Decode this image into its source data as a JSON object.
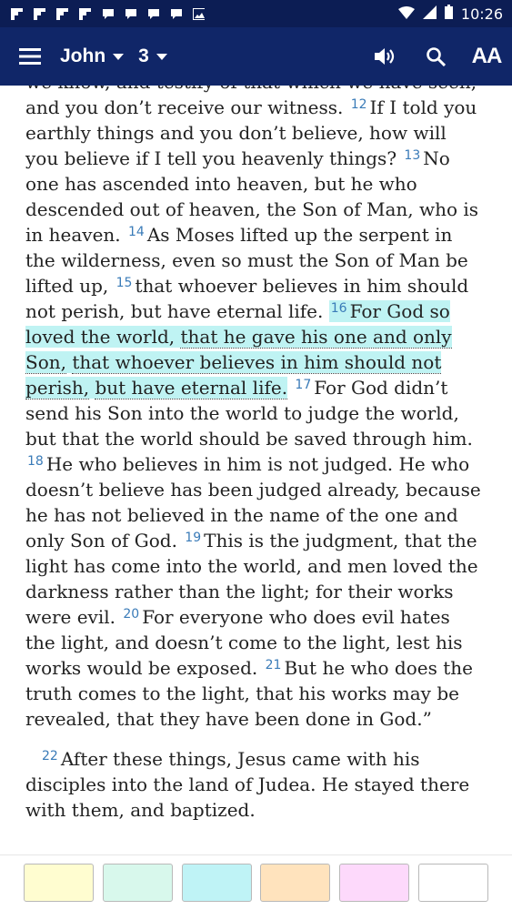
{
  "status_bar": {
    "time": "10:26",
    "notification_icons": [
      "flipboard-icon",
      "flipboard-icon",
      "flipboard-icon",
      "flipboard-icon",
      "message-icon",
      "message-icon",
      "message-icon",
      "message-icon",
      "image-icon"
    ],
    "status_icons": [
      "wifi-icon",
      "signal-icon",
      "battery-icon"
    ]
  },
  "app_bar": {
    "book": "John",
    "chapter": "3",
    "actions": [
      "speaker-icon",
      "search-icon",
      "text-size-icon"
    ],
    "text_size_label": "AA"
  },
  "passage": {
    "p1_top": "we know, and testify of that which we have",
    "p1_a": "seen, and you don’t receive our witness.",
    "v12": "12",
    "t12": "If I told you earthly things and you don’t believe, how will you believe if I tell you heavenly things?",
    "v13": "13",
    "t13": "No one has ascended into heaven, but he who descended out of heaven, the Son of Man, who is in heaven.",
    "v14": "14",
    "t14": "As Moses lifted up the serpent in the wilderness, even so must the Son of Man be lifted up,",
    "v15": "15",
    "t15": "that whoever believes in him should not perish, but have eternal life.",
    "v16": "16",
    "t16a": "For God so loved the world,",
    "t16b": "that he gave his one and only Son,",
    "t16c": "that whoever believes in him should not perish,",
    "t16d": "but have eternal life.",
    "v17": "17",
    "t17": "For God didn’t send his Son into the world to judge the world, but that the world should be saved through him.",
    "v18": "18",
    "t18": "He who believes in him is not judged. He who doesn’t believe has been judged already, because he has not believed in the name of the one and only Son of God.",
    "v19": "19",
    "t19": "This is the judgment, that the light has come into the world, and men loved the darkness rather than the light; for their works were evil.",
    "v20": "20",
    "t20": "For everyone who does evil hates the light, and doesn’t come to the light, lest his works would be exposed.",
    "v21": "21",
    "t21": "But he who does the truth comes to the light, that his works may be revealed, that they have been done in God.”",
    "v22": "22",
    "t22": "After these things, Jesus came with his disciples into the land of Judea. He stayed there with them, and baptized."
  },
  "highlight_palette": [
    "#fffdd0",
    "#d8f8ec",
    "#bff3f6",
    "#ffe3bd",
    "#fdd9fb",
    "#ffffff"
  ],
  "colors": {
    "status_bar": "#0c1d54",
    "app_bar": "#102668",
    "highlight": "#bff3f3",
    "verse_number": "#3a7bb8"
  }
}
